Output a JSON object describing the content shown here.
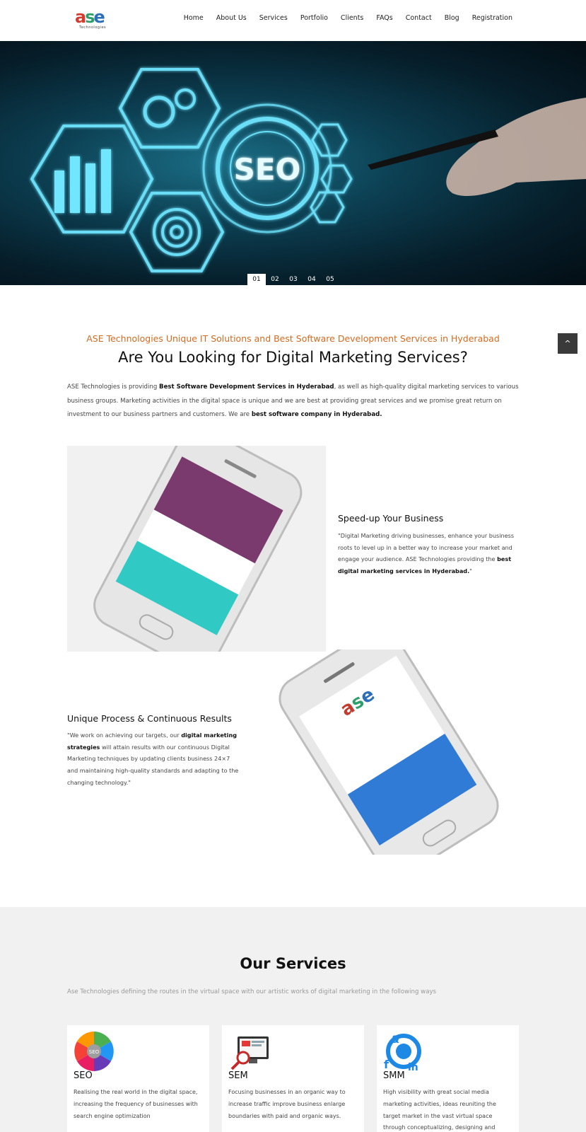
{
  "brand": {
    "logo_a": "a",
    "logo_s": "s",
    "logo_e": "e",
    "logo_sub": "Technologies"
  },
  "nav": [
    "Home",
    "About Us",
    "Services",
    "Portfolio",
    "Clients",
    "FAQs",
    "Contact",
    "Blog",
    "Registration"
  ],
  "hero": {
    "seo_text": "SEO",
    "slides": [
      "01",
      "02",
      "03",
      "04",
      "05"
    ],
    "active_slide": 0
  },
  "back_to_top": "^",
  "intro": {
    "tag": "ASE Technologies Unique IT Solutions and Best Software Development Services in Hyderabad",
    "title": "Are You Looking for Digital Marketing Services?",
    "p1": "ASE Technologies is providing ",
    "p1_bold": "Best Software Development Services in Hyderabad",
    "p2": ", as well as high-quality digital marketing services to various business groups. Marketing activities in the digital space is unique and we are best at providing great services and we promise great return on investment to our business partners and customers. We are ",
    "p2_bold": "best software company in Hyderabad."
  },
  "feature1": {
    "title": "Speed-up Your Business",
    "text": "\"Digital Marketing driving businesses, enhance your business roots to level up in a better way to increase your market and engage your audience. ASE Technologies providing the ",
    "bold": "best digital marketing services in Hyderabad.",
    "end": "\""
  },
  "feature2": {
    "title": "Unique Process & Continuous Results",
    "text1": "\"We work on achieving our targets, our ",
    "bold": "digital marketing strategies",
    "text2": " will attain results with our continuous Digital Marketing techniques by updating clients business 24×7 and maintaining high-quality standards and adapting to the changing technology.\""
  },
  "services": {
    "title": "Our Services",
    "subtitle": "Ase Technologies defining the routes in the virtual space with our artistic works of digital marketing in the following ways",
    "cards": [
      {
        "title": "SEO",
        "text": "Realising the real world in the digital space, increasing the frequency of businesses with search engine optimization",
        "icon": "seo-wheel-icon"
      },
      {
        "title": "SEM",
        "text": "Focusing businesses in an organic way to increase traffic improve business enlarge boundaries with paid and organic ways.",
        "icon": "sem-monitor-icon"
      },
      {
        "title": "SMM",
        "text": "High visibility with great social media marketing activities, ideas reuniting the target market in the vast virtual space through conceptualizing, designing and conveying",
        "icon": "smm-social-icon"
      }
    ]
  },
  "colors": {
    "accent": "#d26a1f",
    "whatsapp": "#25d366",
    "hero_glow": "#5fe3ff"
  }
}
